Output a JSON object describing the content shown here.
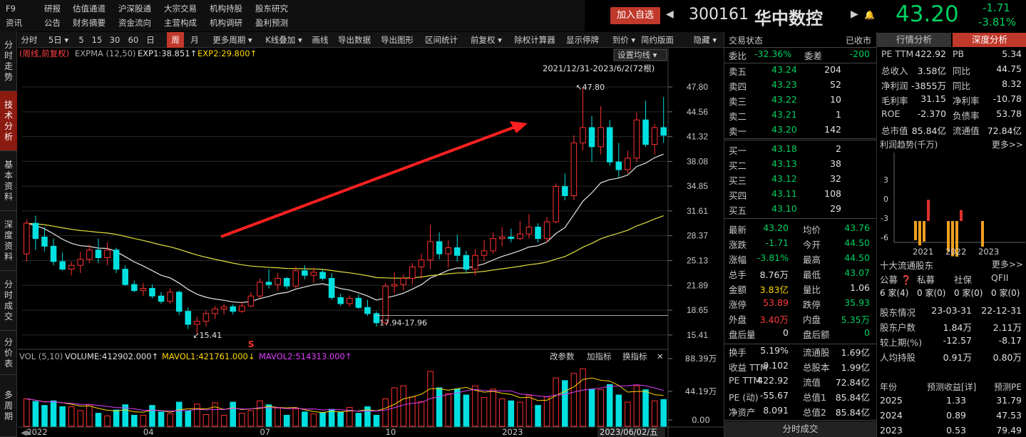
{
  "menu": {
    "row1": [
      "F9",
      "研报",
      "估值通道",
      "沪深股通",
      "大宗交易",
      "机构持股",
      "股东研究"
    ],
    "row2": [
      "资讯",
      "公告",
      "财务摘要",
      "资金流向",
      "主营构成",
      "机构调研",
      "盈利预测"
    ]
  },
  "header": {
    "add_btn": "加入自选",
    "code": "300161",
    "name": "华中数控",
    "price": "43.20",
    "change": "-1.71",
    "pct": "-3.81%"
  },
  "sidebar": [
    "分时走势",
    "技术分析",
    "基本资料",
    "深度资料",
    "分时成交",
    "分价表",
    "多周期"
  ],
  "toolbar": [
    {
      "l": "分时",
      "x": 0,
      "w": 32
    },
    {
      "l": "5日 ▾",
      "x": 34,
      "w": 46
    },
    {
      "l": "5",
      "x": 80,
      "w": 18
    },
    {
      "l": "15",
      "x": 100,
      "w": 22
    },
    {
      "l": "30",
      "x": 124,
      "w": 24
    },
    {
      "l": "60",
      "x": 150,
      "w": 24
    },
    {
      "l": "日",
      "x": 176,
      "w": 20
    },
    {
      "l": "周",
      "x": 209,
      "w": 24,
      "a": true
    },
    {
      "l": "月",
      "x": 236,
      "w": 24
    },
    {
      "l": "更多周期 ▾",
      "x": 264,
      "w": 74
    },
    {
      "l": "K线叠加 ▾",
      "x": 340,
      "w": 66
    },
    {
      "l": "画线",
      "x": 408,
      "w": 32
    },
    {
      "l": "导出数据",
      "x": 444,
      "w": 56
    },
    {
      "l": "导出图形",
      "x": 504,
      "w": 56
    },
    {
      "l": "区间统计",
      "x": 566,
      "w": 56
    },
    {
      "l": "前复权 ▾",
      "x": 628,
      "w": 58
    },
    {
      "l": "除权计算器",
      "x": 690,
      "w": 70
    },
    {
      "l": "显示停牌",
      "x": 764,
      "w": 56
    },
    {
      "l": "到价 ▾",
      "x": 826,
      "w": 48
    },
    {
      "l": "简约版面",
      "x": 870,
      "w": 54
    },
    {
      "l": "隐藏 ▾",
      "x": 938,
      "w": 52
    }
  ],
  "legend1": {
    "a": "(周线,前复权)",
    "b": "EXPMA (12,50)",
    "c": "EXP1:38.851↑",
    "d": "EXP2:29.800↑"
  },
  "settings": "设置均线 ▾",
  "range": "2021/12/31-2023/6/2(72根)",
  "legend2": {
    "a": "VOL (5,10)",
    "b": "VOLUME:412902.000↑",
    "c": "MAVOL1:421761.000↓",
    "d": "MAVOL2:514313.000↑"
  },
  "vol_btns": [
    "改参数",
    "加指标",
    "换指标",
    "✕"
  ],
  "annotations": {
    "hi": "47.80",
    "lo": "15.41",
    "low_range": "17.94-17.96",
    "date_tag": "2023/06/02/五",
    "marker": "S"
  },
  "chart_data": {
    "type": "candlestick",
    "ylim": [
      14.0,
      49.2
    ],
    "yticks": [
      "47.80",
      "44.56",
      "41.32",
      "38.08",
      "34.85",
      "31.61",
      "28.37",
      "25.13",
      "21.89",
      "18.65",
      "15.41"
    ],
    "vol_ticks": [
      "88.39万",
      "44.19万",
      "0.00"
    ],
    "vol_max": 883900,
    "xticks": [
      "2022",
      "04",
      "07",
      "10",
      "2023",
      "0"
    ],
    "ohlc": [
      [
        26,
        30.5,
        25,
        30
      ],
      [
        30,
        31,
        26.5,
        28
      ],
      [
        28.2,
        29.5,
        26.3,
        27
      ],
      [
        27,
        28,
        24.5,
        25
      ],
      [
        25,
        26.2,
        23.8,
        24
      ],
      [
        24,
        25,
        23.2,
        24.5
      ],
      [
        24.5,
        26.3,
        23.5,
        25.3
      ],
      [
        25.3,
        27.2,
        24.8,
        26.5
      ],
      [
        26.5,
        28,
        24.8,
        25.5
      ],
      [
        25.5,
        27.5,
        24.5,
        26.5
      ],
      [
        26.5,
        26.8,
        23.5,
        24
      ],
      [
        24,
        24.5,
        21.8,
        22
      ],
      [
        22,
        22.5,
        21,
        21.2
      ],
      [
        21.2,
        22.2,
        20.5,
        21.5
      ],
      [
        21.5,
        22,
        20.2,
        20.5
      ],
      [
        20.5,
        21,
        19.5,
        19.8
      ],
      [
        19.8,
        21.5,
        19.5,
        21
      ],
      [
        21,
        21.2,
        18,
        18.5
      ],
      [
        18.5,
        19,
        16.2,
        16.8
      ],
      [
        16.8,
        17.8,
        15.41,
        17.2
      ],
      [
        17.2,
        18.6,
        16.5,
        18.2
      ],
      [
        18.2,
        19.2,
        17.5,
        18.8
      ],
      [
        18.8,
        19.5,
        18.1,
        19.1
      ],
      [
        19.1,
        19.4,
        18.1,
        18.5
      ],
      [
        18.5,
        19.8,
        18.3,
        19.2
      ],
      [
        19.2,
        21,
        19,
        20.5
      ],
      [
        20.5,
        22.8,
        20.2,
        22.3
      ],
      [
        22.3,
        24,
        21.5,
        22
      ],
      [
        22,
        23.5,
        21.2,
        22.8
      ],
      [
        22.8,
        23,
        21.4,
        21.8
      ],
      [
        21.8,
        24.3,
        21.5,
        23.8
      ],
      [
        23.8,
        24.5,
        22.7,
        23.2
      ],
      [
        23.2,
        24.2,
        22.2,
        23.6
      ],
      [
        23.6,
        24,
        22.5,
        22.8
      ],
      [
        22.8,
        23.5,
        20,
        20.3
      ],
      [
        20.3,
        20.8,
        19.2,
        19.5
      ],
      [
        19.5,
        20.6,
        19.1,
        20.2
      ],
      [
        20.2,
        20.7,
        18.8,
        19
      ],
      [
        19,
        20,
        17.9,
        18.2
      ],
      [
        18.2,
        18.5,
        16.5,
        17
      ],
      [
        17,
        22.2,
        16.8,
        21.8
      ],
      [
        21.8,
        23.6,
        20.8,
        22
      ],
      [
        22,
        23.3,
        21.2,
        22.8
      ],
      [
        22.8,
        24.8,
        22,
        24.3
      ],
      [
        24.3,
        26,
        22.8,
        25.2
      ],
      [
        25.2,
        29.8,
        24,
        27.6
      ],
      [
        27.6,
        28.8,
        25.3,
        26
      ],
      [
        26,
        27.8,
        24.2,
        26.8
      ],
      [
        26.8,
        28.5,
        25,
        25.8
      ],
      [
        25.8,
        26.4,
        23.5,
        24
      ],
      [
        24,
        26.6,
        23.2,
        25.8
      ],
      [
        25.8,
        27.8,
        25.1,
        26.4
      ],
      [
        26.4,
        28.8,
        26,
        28
      ],
      [
        28,
        29.5,
        27,
        28.2
      ],
      [
        28.2,
        29.3,
        27.5,
        28
      ],
      [
        28,
        30.3,
        27.8,
        28.6
      ],
      [
        28.6,
        31.2,
        28,
        29.5
      ],
      [
        29.5,
        30,
        27.5,
        28
      ],
      [
        28,
        30.8,
        27.5,
        30.2
      ],
      [
        30.2,
        35.2,
        30,
        34.8
      ],
      [
        34.8,
        36.5,
        33,
        33.6
      ],
      [
        33.6,
        41.5,
        33,
        40.5
      ],
      [
        40.5,
        47.8,
        39.5,
        42.5
      ],
      [
        42.5,
        44,
        38,
        40
      ],
      [
        40,
        45.3,
        39,
        42.5
      ],
      [
        42.5,
        43.5,
        37.5,
        38
      ],
      [
        38,
        40.5,
        36,
        37
      ],
      [
        37,
        39.5,
        36.5,
        38.5
      ],
      [
        38.5,
        44.5,
        38,
        43.5
      ],
      [
        43.5,
        46,
        40,
        40.3
      ],
      [
        40.3,
        43,
        39,
        42.5
      ],
      [
        42.5,
        46.5,
        40.5,
        41.5
      ]
    ],
    "volume": [
      420000,
      380000,
      320000,
      390000,
      300000,
      300000,
      240000,
      330000,
      200000,
      160000,
      250000,
      330000,
      170000,
      170000,
      320000,
      220000,
      190000,
      370000,
      240000,
      340000,
      180000,
      360000,
      170000,
      370000,
      200000,
      240000,
      390000,
      330000,
      280000,
      170000,
      270000,
      220000,
      190000,
      210000,
      260000,
      220000,
      290000,
      200000,
      300000,
      170000,
      420000,
      590000,
      620000,
      450000,
      380000,
      840000,
      590000,
      500000,
      570000,
      480000,
      620000,
      440000,
      570000,
      420000,
      390000,
      370000,
      470000,
      320000,
      450000,
      740000,
      700000,
      810000,
      880000,
      570000,
      560000,
      640000,
      480000,
      370000,
      620000,
      560000,
      390000,
      410000
    ]
  }
}
